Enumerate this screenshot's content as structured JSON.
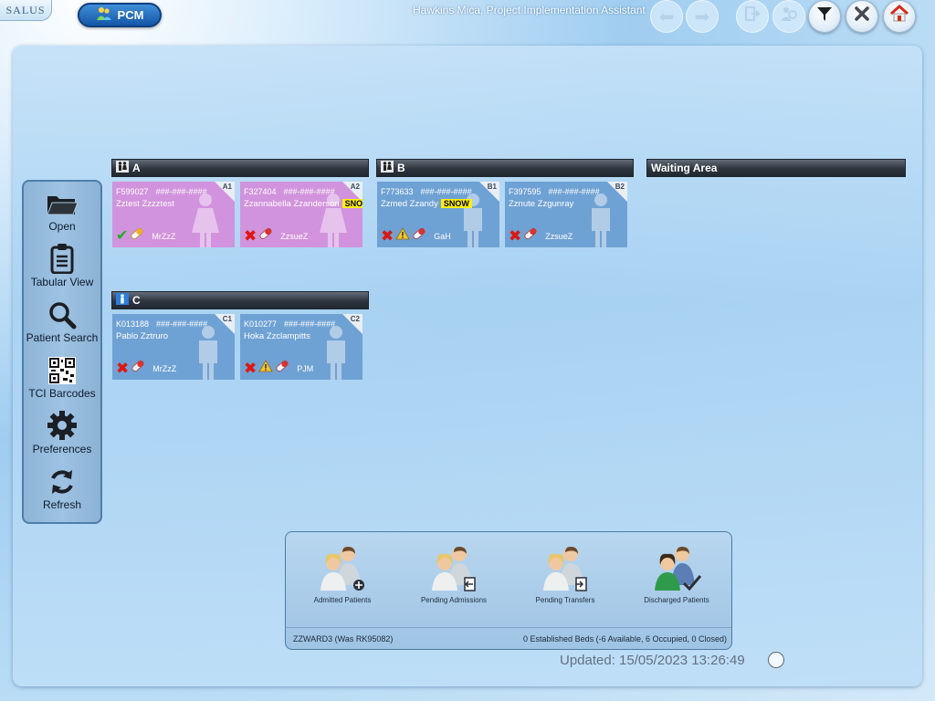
{
  "app": {
    "logo_text": "SALUS",
    "module_label": "PCM",
    "user_title": "Hawkins Mica, Project Implementation Assistant"
  },
  "toolbar": {
    "buttons": [
      {
        "name": "back",
        "icon": "arrow-left-icon",
        "enabled": false
      },
      {
        "name": "forward",
        "icon": "arrow-right-icon",
        "enabled": false
      },
      {
        "name": "exit",
        "icon": "exit-door-icon",
        "enabled": false
      },
      {
        "name": "users",
        "icon": "users-settings-icon",
        "enabled": false
      },
      {
        "name": "filter",
        "icon": "filter-icon",
        "enabled": true
      },
      {
        "name": "close",
        "icon": "close-icon",
        "enabled": true
      },
      {
        "name": "home",
        "icon": "home-icon",
        "enabled": true
      }
    ]
  },
  "nav": {
    "items": [
      {
        "label": "Open",
        "icon": "folder-icon"
      },
      {
        "label": "Tabular View",
        "icon": "clipboard-icon"
      },
      {
        "label": "Patient Search",
        "icon": "magnifier-icon"
      },
      {
        "label": "TCI Barcodes",
        "icon": "qr-code-icon"
      },
      {
        "label": "Preferences",
        "icon": "gear-icon"
      },
      {
        "label": "Refresh",
        "icon": "refresh-icon"
      }
    ]
  },
  "wards": [
    {
      "label": "A",
      "icon": "mixed-bay-icon"
    },
    {
      "label": "B",
      "icon": "mixed-bay-icon"
    },
    {
      "label": "Waiting Area"
    },
    {
      "label": "C",
      "icon": "male-bay-icon"
    }
  ],
  "beds": [
    {
      "code": "A1",
      "id": "F599027",
      "nhs": "###-###-####",
      "name": "Zztest Zzzztest",
      "badge": "",
      "sex": "female",
      "discharge": "tick",
      "warning": false,
      "staff": "MrZzZ"
    },
    {
      "code": "A2",
      "id": "F327404",
      "nhs": "###-###-####",
      "name": "Zzannabella Zzanderson",
      "badge": "SNOW",
      "sex": "female",
      "discharge": "x",
      "warning": false,
      "staff": "ZzsueZ"
    },
    {
      "code": "B1",
      "id": "F773633",
      "nhs": "###-###-####",
      "name": "Zzmed Zzandy",
      "badge": "SNOW",
      "sex": "male",
      "discharge": "x",
      "warning": true,
      "staff": "GaH"
    },
    {
      "code": "B2",
      "id": "F397595",
      "nhs": "###-###-####",
      "name": "Zznute Zzgunray",
      "badge": "",
      "sex": "male",
      "discharge": "x",
      "warning": false,
      "staff": "ZzsueZ"
    },
    {
      "code": "C1",
      "id": "K013188",
      "nhs": "###-###-####",
      "name": "Pablo Zztruro",
      "badge": "",
      "sex": "male",
      "discharge": "x",
      "warning": false,
      "staff": "MrZzZ"
    },
    {
      "code": "C2",
      "id": "K010277",
      "nhs": "###-###-####",
      "name": "Hoka Zzclampitts",
      "badge": "",
      "sex": "male",
      "discharge": "x",
      "warning": true,
      "staff": "PJM"
    }
  ],
  "bottom_panel": {
    "items": [
      {
        "label": "Admitted Patients",
        "icon": "admitted-patients-icon"
      },
      {
        "label": "Pending Admissions",
        "icon": "pending-admissions-icon"
      },
      {
        "label": "Pending Transfers",
        "icon": "pending-transfers-icon"
      },
      {
        "label": "Discharged Patients",
        "icon": "discharged-patients-icon"
      }
    ],
    "ward_name": "ZZWARD3 (Was RK95082)",
    "bed_summary": "0 Established Beds (-6 Available, 6 Occupied, 0 Closed)"
  },
  "updated": "Updated: 15/05/2023 13:26:49",
  "colors": {
    "female_bed": "#d193dd",
    "male_bed": "#6fa2d4",
    "snow_badge": "#ffef00",
    "header_dark": "#2e353e"
  }
}
